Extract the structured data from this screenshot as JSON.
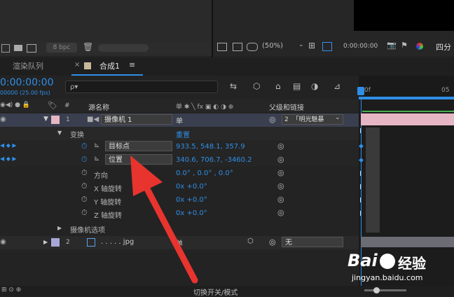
{
  "top": {
    "bpc": "8 bpc",
    "zoom": "(50%)",
    "timecode": "0:00:00:00",
    "view_label": "四分"
  },
  "tabs": {
    "render_queue": "渲染队列",
    "comp": "合成1",
    "menu": "≡",
    "close": "×"
  },
  "timeline": {
    "time": "0:00:00:00",
    "fps": "00000 (25.00 fps)",
    "search_placeholder": "ρ▾",
    "ruler_start": "0f",
    "ruler_next": "05"
  },
  "columns": {
    "hash": "#",
    "source_name": "源名称",
    "switches": "单 ✱ ╲ fx ▣ ◐ ◑ ⊕",
    "parent": "父级和链接"
  },
  "layers": [
    {
      "num": "1",
      "name": "摄像机 1",
      "parent_num": "2",
      "parent_name": "「明光魅暴"
    },
    {
      "num": "2",
      "name": ". . . . . jpg",
      "parent_name": "无"
    }
  ],
  "properties": {
    "transform": "变换",
    "reset": "重置",
    "point_of_interest": "目标点",
    "poi_value": "933.5, 548.1, 357.9",
    "position": "位置",
    "pos_value": "340.6, 706.7, -3460.2",
    "orientation": "方向",
    "orientation_value": "0.0° , 0.0° , 0.0°",
    "x_rotation": "X 轴旋转",
    "x_value": "0x +0.0°",
    "y_rotation": "Y 轴旋转",
    "y_value": "0x +0.0°",
    "z_rotation": "Z 轴旋转",
    "z_value": "0x +0.0°",
    "camera_options": "摄像机选项"
  },
  "footer": {
    "toggle_label": "切换开关/模式"
  },
  "watermark": {
    "brand": "Bai",
    "brand2": "经验",
    "url": "jingyan.baidu.com"
  },
  "colors": {
    "accent_blue": "#2f8ee6",
    "arrow_red": "#e8342e",
    "layer_pink": "#e6b6c4"
  }
}
